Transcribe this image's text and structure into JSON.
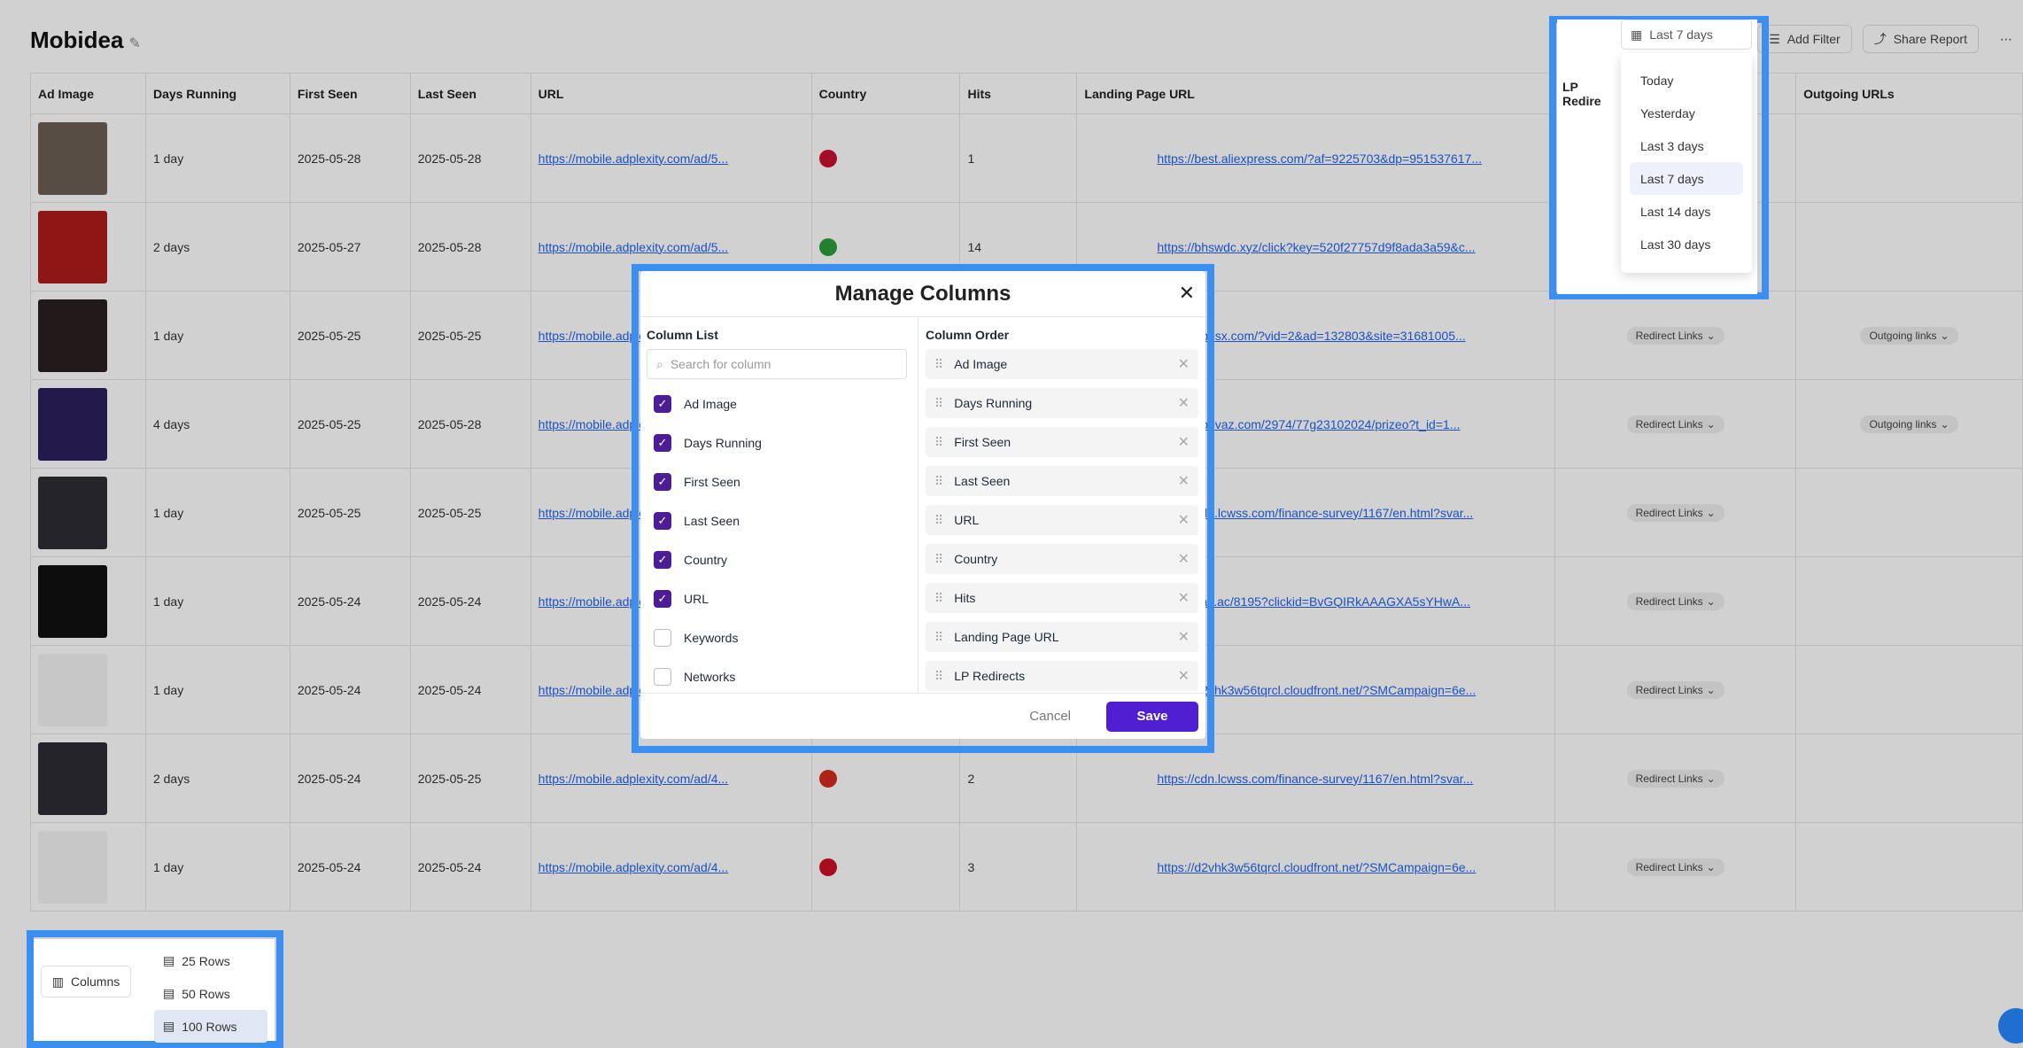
{
  "page": {
    "title": "Mobidea"
  },
  "toolbar": {
    "date_label": "Last 7 days",
    "add_filter": "Add Filter",
    "share_report": "Share Report"
  },
  "table": {
    "headers": [
      "Ad Image",
      "Days Running",
      "First Seen",
      "Last Seen",
      "URL",
      "Country",
      "Hits",
      "Landing Page URL",
      "LP Redirects",
      "Outgoing URLs"
    ],
    "rows": [
      {
        "days": "1 day",
        "first": "2025-05-28",
        "last": "2025-05-28",
        "url": "https://mobile.adplexity.com/ad/5...",
        "hits": "1",
        "lp": "https://best.aliexpress.com/?af=9225703&dp=951537617...",
        "redirect": "",
        "outgoing": ""
      },
      {
        "days": "2 days",
        "first": "2025-05-27",
        "last": "2025-05-28",
        "url": "https://mobile.adplexity.com/ad/5...",
        "hits": "14",
        "lp": "https://bhswdc.xyz/click?key=520f27757d9f8ada3a59&c...",
        "redirect": "",
        "outgoing": ""
      },
      {
        "days": "1 day",
        "first": "2025-05-25",
        "last": "2025-05-25",
        "url": "https://mobile.adplexity.com/ad/5...",
        "hits": "",
        "lp": "https://ubesx.com/?vid=2&ad=132803&site=31681005...",
        "redirect": "Redirect Links",
        "outgoing": "Outgoing links"
      },
      {
        "days": "4 days",
        "first": "2025-05-25",
        "last": "2025-05-28",
        "url": "https://mobile.adplexity.com/ad/5...",
        "hits": "",
        "lp": "https://nobvaz.com/2974/77g23102024/prizeo?t_id=1...",
        "redirect": "Redirect Links",
        "outgoing": "Outgoing links"
      },
      {
        "days": "1 day",
        "first": "2025-05-25",
        "last": "2025-05-25",
        "url": "https://mobile.adplexity.com/ad/5...",
        "hits": "",
        "lp": "https://cdn.lcwss.com/finance-survey/1167/en.html?svar...",
        "redirect": "Redirect Links",
        "outgoing": ""
      },
      {
        "days": "1 day",
        "first": "2025-05-24",
        "last": "2025-05-24",
        "url": "https://mobile.adplexity.com/ad/4...",
        "hits": "",
        "lp": "https://vas.ac/8195?clickid=BvGQIRkAAAGXA5sYHwA...",
        "redirect": "Redirect Links",
        "outgoing": ""
      },
      {
        "days": "1 day",
        "first": "2025-05-24",
        "last": "2025-05-24",
        "url": "https://mobile.adplexity.com/ad/4...",
        "hits": "",
        "lp": "https://d2vhk3w56tqrcl.cloudfront.net/?SMCampaign=6e...",
        "redirect": "Redirect Links",
        "outgoing": ""
      },
      {
        "days": "2 days",
        "first": "2025-05-24",
        "last": "2025-05-25",
        "url": "https://mobile.adplexity.com/ad/4...",
        "hits": "2",
        "lp": "https://cdn.lcwss.com/finance-survey/1167/en.html?svar...",
        "redirect": "Redirect Links",
        "outgoing": ""
      },
      {
        "days": "1 day",
        "first": "2025-05-24",
        "last": "2025-05-24",
        "url": "https://mobile.adplexity.com/ad/4...",
        "hits": "3",
        "lp": "https://d2vhk3w56tqrcl.cloudfront.net/?SMCampaign=6e...",
        "redirect": "Redirect Links",
        "outgoing": ""
      }
    ]
  },
  "modal": {
    "title": "Manage Columns",
    "column_list_title": "Column List",
    "search_placeholder": "Search for column",
    "column_list": [
      {
        "label": "Ad Image",
        "checked": true
      },
      {
        "label": "Days Running",
        "checked": true
      },
      {
        "label": "First Seen",
        "checked": true
      },
      {
        "label": "Last Seen",
        "checked": true
      },
      {
        "label": "Country",
        "checked": true
      },
      {
        "label": "URL",
        "checked": true
      },
      {
        "label": "Keywords",
        "checked": false
      },
      {
        "label": "Networks",
        "checked": false
      }
    ],
    "column_order_title": "Column Order",
    "column_order": [
      "Ad Image",
      "Days Running",
      "First Seen",
      "Last Seen",
      "URL",
      "Country",
      "Hits",
      "Landing Page URL",
      "LP Redirects"
    ],
    "cancel": "Cancel",
    "save": "Save"
  },
  "date_dropdown": {
    "options": [
      "Today",
      "Yesterday",
      "Last 3 days",
      "Last 7 days",
      "Last 14 days",
      "Last 30 days"
    ],
    "selected": "Last 7 days",
    "bg_label": "LP Redire"
  },
  "rows_menu": {
    "columns_button": "Columns",
    "options": [
      "25 Rows",
      "50 Rows",
      "100 Rows"
    ],
    "selected": "100 Rows"
  },
  "colors": {
    "accent": "#4f1fd1",
    "highlight": "#3b8ff0",
    "link": "#2563eb"
  }
}
